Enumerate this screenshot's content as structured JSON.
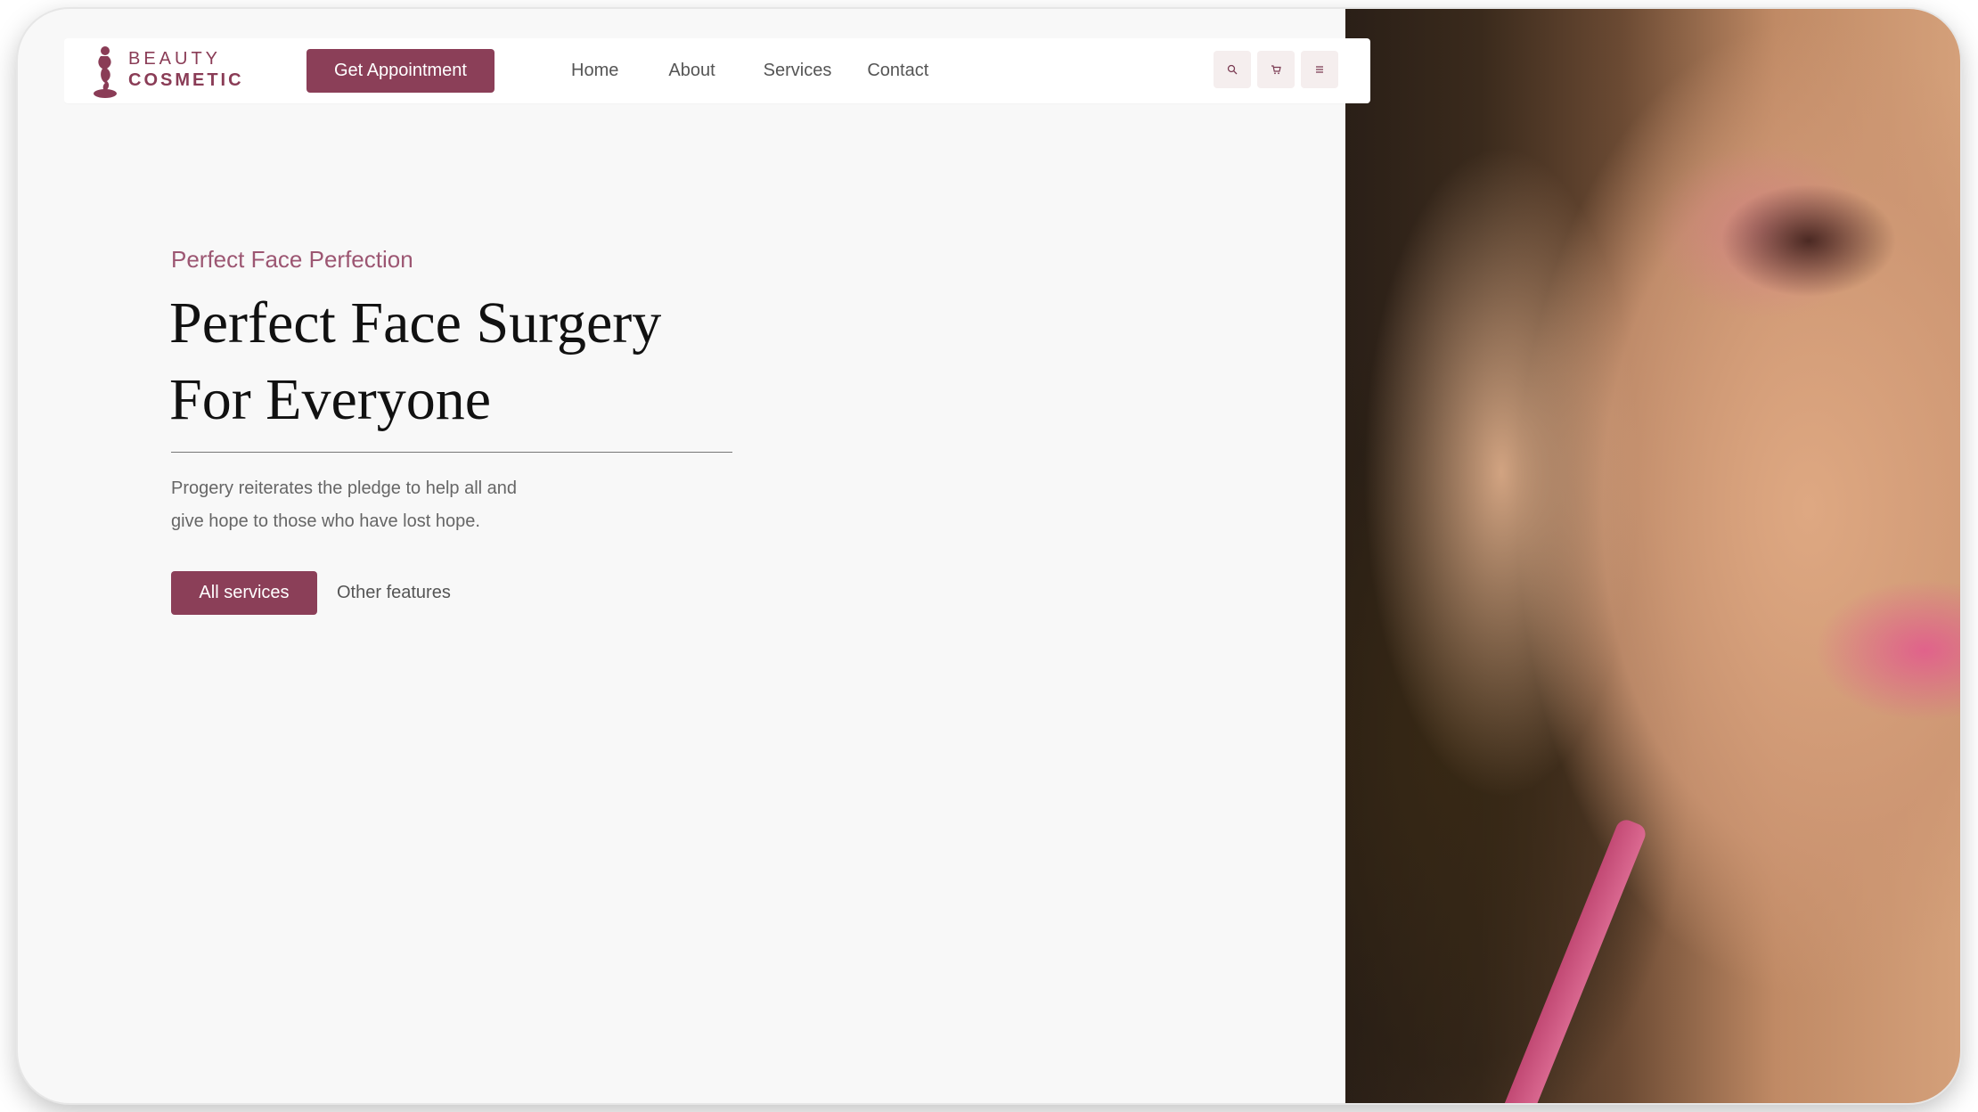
{
  "brand": {
    "name_line1": "BEAUTY",
    "name_line2": "COSMETIC",
    "icon": "woman-figure-logo"
  },
  "header": {
    "cta_label": "Get Appointment",
    "nav": [
      {
        "label": "Home"
      },
      {
        "label": "About"
      },
      {
        "label": "Services"
      },
      {
        "label": "Contact"
      }
    ],
    "icons": [
      "search-icon",
      "cart-icon",
      "menu-icon"
    ]
  },
  "hero": {
    "kicker": "Perfect Face Perfection",
    "title_line1": "Perfect Face Surgery",
    "title_line2": "For Everyone",
    "description_line1": "Progery reiterates the pledge to help all and",
    "description_line2": "give hope to those who have lost hope.",
    "primary_button": "All services",
    "secondary_link": "Other features"
  },
  "colors": {
    "accent": "#8b3f58",
    "kicker": "#9c5672",
    "background": "#f8f8f8"
  }
}
